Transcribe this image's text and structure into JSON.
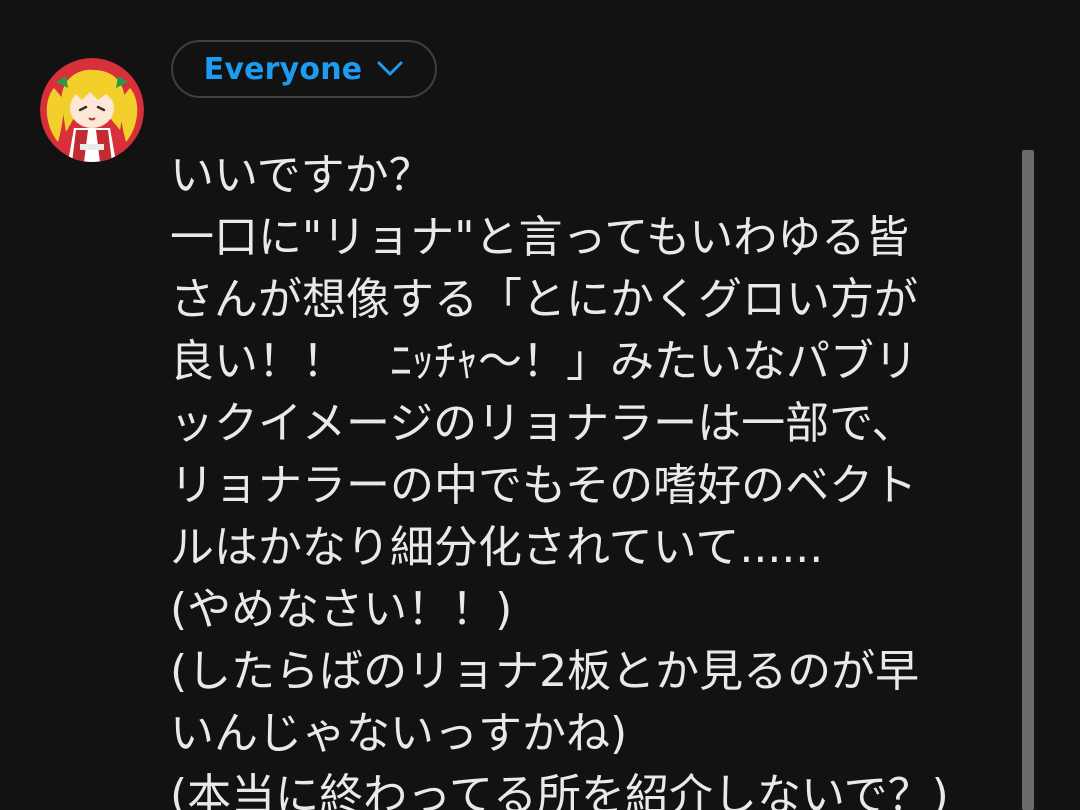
{
  "audience": {
    "label": "Everyone",
    "icon": "chevron-down-icon",
    "color": "#1d9bf0"
  },
  "avatar": {
    "icon": "user-avatar-anime-girl",
    "colors": [
      "#d7303a",
      "#f2cf2a",
      "#ffffff"
    ]
  },
  "post": {
    "lines": [
      "いいですか？",
      "一口に\"リョナ\"と言ってもいわゆる皆",
      "さんが想像する「とにかくグロい方が",
      "良い！！　ﾆｯﾁｬ〜！」みたいなパブリ",
      "ックイメージのリョナラーは一部で、",
      "リョナラーの中でもその嗜好のベクト",
      "ルはかなり細分化されていて......",
      "(やめなさい！！)",
      "(したらばのリョナ2板とか見るのが早",
      "いんじゃないっすかね)",
      "(本当に終わってる所を紹介しないで？)"
    ]
  },
  "theme": {
    "background": "#121212",
    "text": "#e7e9ea",
    "border": "#3a4046",
    "scrollbar": "#6b6b6b"
  }
}
